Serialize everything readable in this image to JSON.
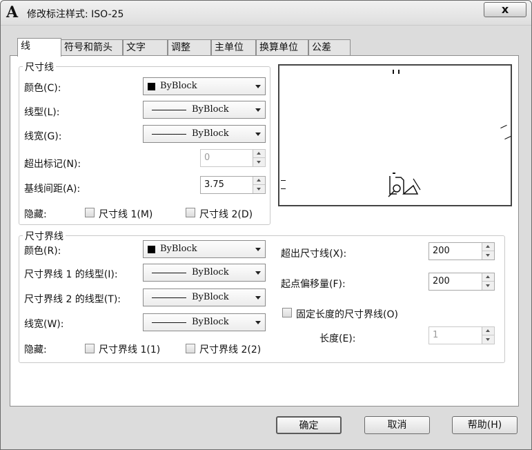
{
  "window": {
    "title": "修改标注样式: ISO-25",
    "app_icon": "A",
    "close_symbol": "x"
  },
  "tabs": [
    {
      "label": "线"
    },
    {
      "label": "符号和箭头"
    },
    {
      "label": "文字"
    },
    {
      "label": "调整"
    },
    {
      "label": "主单位"
    },
    {
      "label": "换算单位"
    },
    {
      "label": "公差"
    }
  ],
  "dimension_lines": {
    "title": "尺寸线",
    "color_label": "颜色(C):",
    "color_value": "ByBlock",
    "linetype_label": "线型(L):",
    "linetype_value": "ByBlock",
    "lineweight_label": "线宽(G):",
    "lineweight_value": "ByBlock",
    "extend_ticks_label": "超出标记(N):",
    "extend_ticks_value": "0",
    "baseline_spacing_label": "基线间距(A):",
    "baseline_spacing_value": "3.75",
    "suppress_label": "隐藏:",
    "suppress_1": "尺寸线 1(M)",
    "suppress_2": "尺寸线 2(D)"
  },
  "extension_lines": {
    "title": "尺寸界线",
    "color_label": "颜色(R):",
    "color_value": "ByBlock",
    "linetype1_label": "尺寸界线 1 的线型(I):",
    "linetype1_value": "ByBlock",
    "linetype2_label": "尺寸界线 2 的线型(T):",
    "linetype2_value": "ByBlock",
    "lineweight_label": "线宽(W):",
    "lineweight_value": "ByBlock",
    "suppress_label": "隐藏:",
    "suppress_1": "尺寸界线 1(1)",
    "suppress_2": "尺寸界线 2(2)",
    "extend_beyond_label": "超出尺寸线(X):",
    "extend_beyond_value": "200",
    "offset_label": "起点偏移量(F):",
    "offset_value": "200",
    "fixed_length_label": "固定长度的尺寸界线(O)",
    "length_label": "长度(E):",
    "length_value": "1"
  },
  "buttons": {
    "ok": "确定",
    "cancel": "取消",
    "help": "帮助(H)"
  }
}
